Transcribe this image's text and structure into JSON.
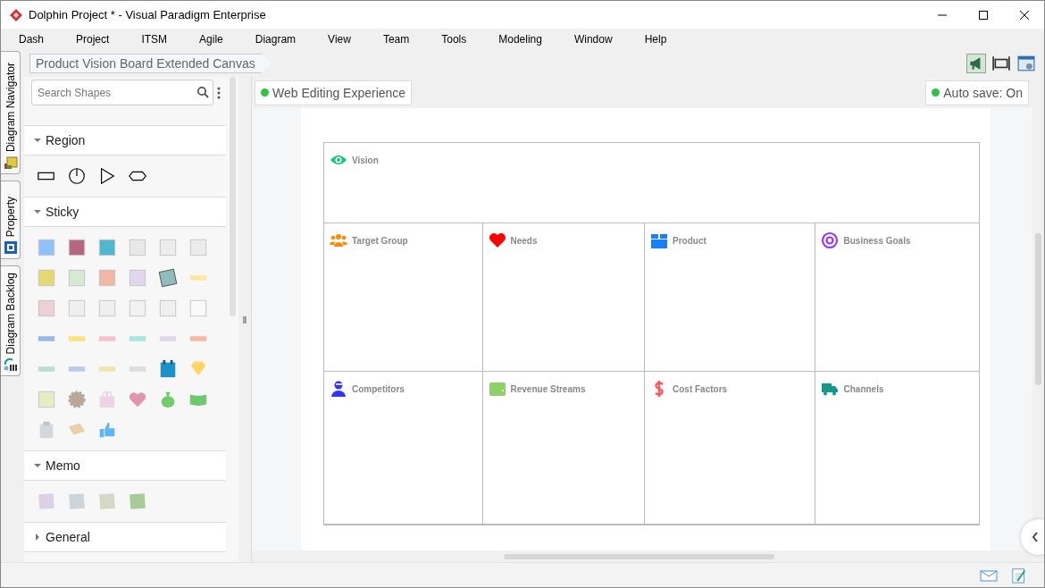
{
  "window": {
    "title": "Dolphin Project * - Visual Paradigm Enterprise"
  },
  "menu": [
    "Dash",
    "Project",
    "ITSM",
    "Agile",
    "Diagram",
    "View",
    "Team",
    "Tools",
    "Modeling",
    "Window",
    "Help"
  ],
  "side_tabs": [
    {
      "label": "Diagram Navigator"
    },
    {
      "label": "Property"
    },
    {
      "label": "Diagram Backlog"
    }
  ],
  "breadcrumb": "Product Vision Board Extended Canvas",
  "shape_panel": {
    "search": {
      "placeholder": "Search Shapes"
    },
    "sections": [
      {
        "title": "Region",
        "expanded": true
      },
      {
        "title": "Sticky",
        "expanded": true
      },
      {
        "title": "Memo",
        "expanded": true
      },
      {
        "title": "General",
        "expanded": false
      }
    ]
  },
  "canvas": {
    "badges": [
      "Web Editing Experience",
      "Auto save: On"
    ],
    "board": {
      "rows": [
        [
          "Vision"
        ],
        [
          "Target Group",
          "Needs",
          "Product",
          "Business Goals"
        ],
        [
          "Competitors",
          "Revenue Streams",
          "Cost Factors",
          "Channels"
        ]
      ]
    }
  }
}
